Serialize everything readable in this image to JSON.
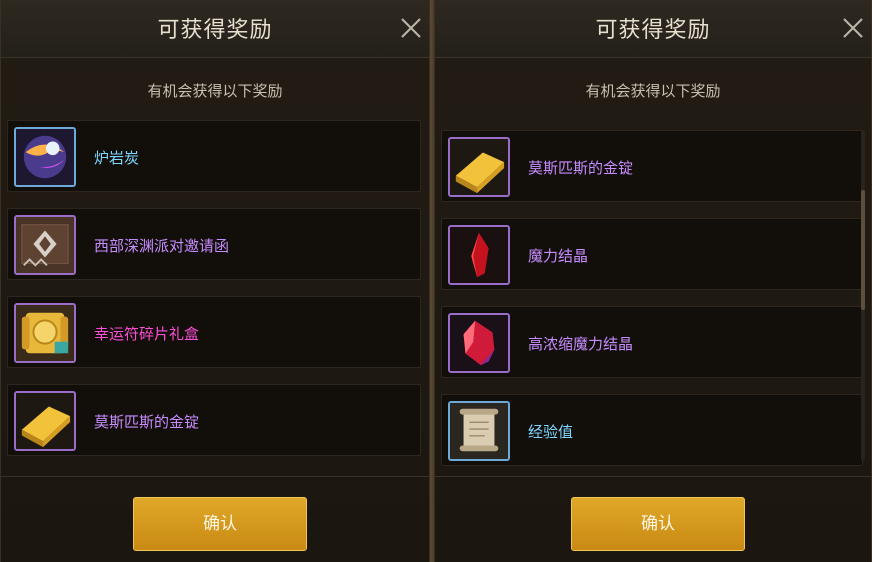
{
  "left_panel": {
    "title": "可获得奖励",
    "subtitle": "有机会获得以下奖励",
    "items": [
      {
        "label": "炉岩炭",
        "color": "#7fd7ff",
        "icon": "orb-icon"
      },
      {
        "label": "西部深渊派对邀请函",
        "color": "#c78cff",
        "icon": "invitation-icon"
      },
      {
        "label": "幸运符碎片礼盒",
        "color": "#ff4fd8",
        "icon": "scroll-box-icon"
      },
      {
        "label": "莫斯匹斯的金锭",
        "color": "#c78cff",
        "icon": "gold-bar-icon"
      }
    ],
    "confirm_label": "确认"
  },
  "right_panel": {
    "title": "可获得奖励",
    "subtitle": "有机会获得以下奖励",
    "items": [
      {
        "label": "莫斯匹斯的金锭",
        "color": "#c78cff",
        "icon": "gold-bar-icon"
      },
      {
        "label": "魔力结晶",
        "color": "#c78cff",
        "icon": "red-crystal-icon"
      },
      {
        "label": "高浓缩魔力结晶",
        "color": "#c78cff",
        "icon": "red-crystal-large-icon"
      },
      {
        "label": "经验值",
        "color": "#7fd7ff",
        "icon": "parchment-icon"
      }
    ],
    "confirm_label": "确认"
  },
  "colors": {
    "button": "#d99a1e",
    "panel_bg": "#1e1812",
    "row_bg": "#120e0a"
  }
}
